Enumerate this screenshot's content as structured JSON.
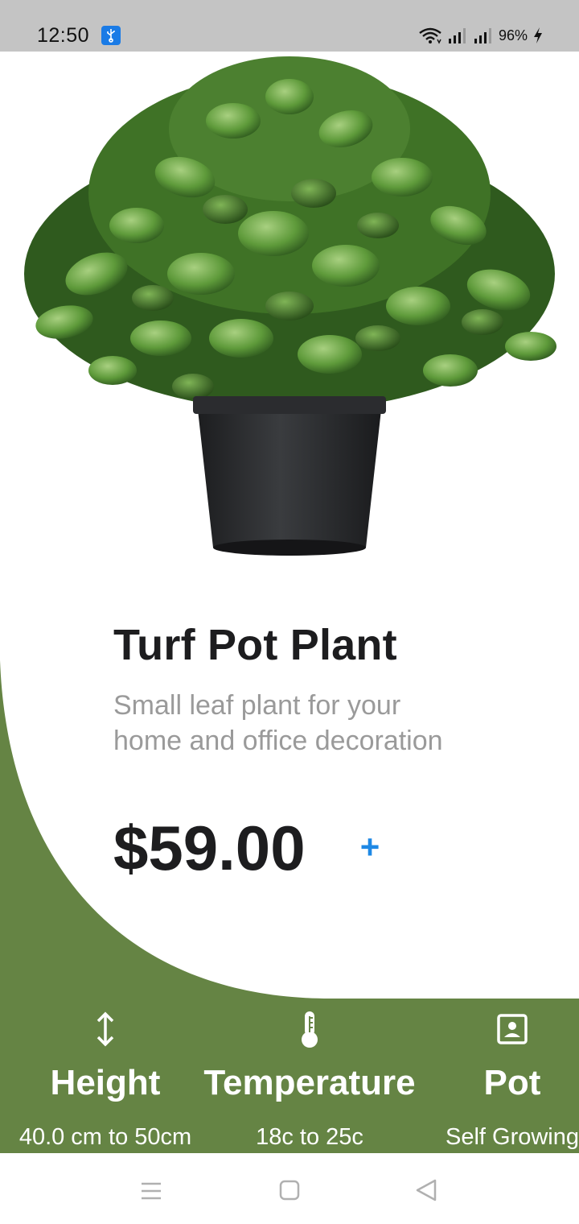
{
  "status_bar": {
    "time": "12:50",
    "usb_icon": "usb-icon",
    "wifi_icon": "wifi-icon",
    "signal_icon": "cell-signal-icon",
    "battery": "96%",
    "charging_icon": "charging-bolt-icon"
  },
  "product": {
    "image": "potted-plant-image",
    "name": "Turf Pot Plant",
    "description": "Small leaf plant for your home and office decoration",
    "price": "$59.00",
    "add_label": "+"
  },
  "specs": [
    {
      "icon": "height-arrows-icon",
      "label": "Height",
      "value": "40.0 cm to 50cm"
    },
    {
      "icon": "thermometer-icon",
      "label": "Temperature",
      "value": "18c to 25c"
    },
    {
      "icon": "pot-portrait-icon",
      "label": "Pot",
      "value": "Self Growing"
    }
  ],
  "nav_bar": {
    "menu_icon": "menu-icon",
    "home_icon": "home-square-icon",
    "back_icon": "back-triangle-icon"
  },
  "colors": {
    "accent_green": "#658444",
    "price_plus": "#1e88e5",
    "status_bar": "#c4c4c4"
  }
}
